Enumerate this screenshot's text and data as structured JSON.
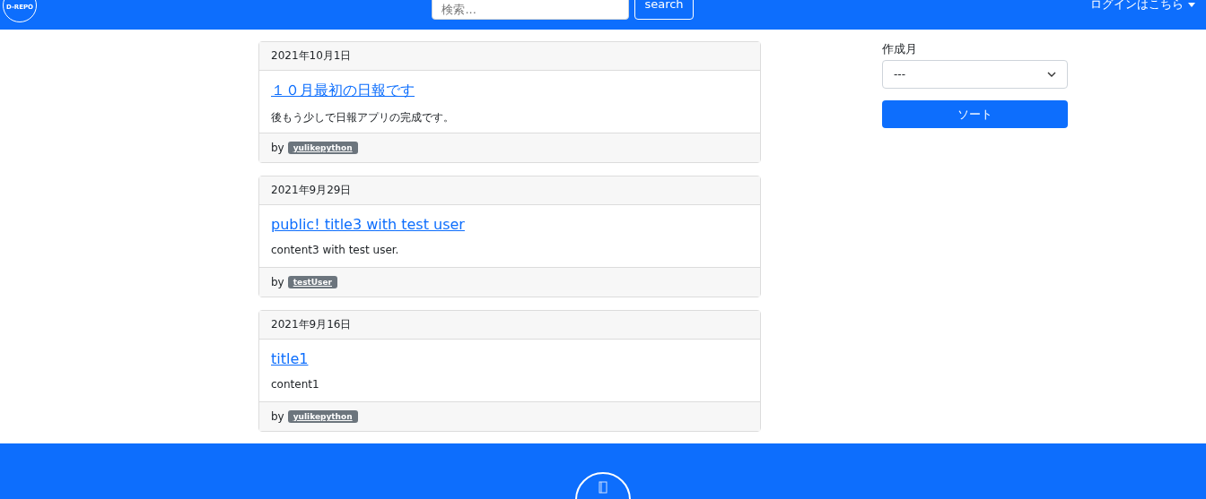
{
  "header": {
    "logo": "D-REPO",
    "search": {
      "placeholder": "検索..."
    },
    "search_button": "search",
    "login_menu": "ログインはこちら"
  },
  "posts": [
    {
      "date": "2021年10月1日",
      "title": "１０月最初の日報です",
      "content": "後もう少しで日報アプリの完成です。",
      "by": "by",
      "author": "yulikepython"
    },
    {
      "date": "2021年9月29日",
      "title": "public! title3 with test user",
      "content": "content3 with test user.",
      "by": "by",
      "author": "testUser"
    },
    {
      "date": "2021年9月16日",
      "title": "title1",
      "content": "content1",
      "by": "by",
      "author": "yulikepython"
    }
  ],
  "sidebar": {
    "month_label": "作成月",
    "month_value": "---",
    "sort_button": "ソート"
  }
}
